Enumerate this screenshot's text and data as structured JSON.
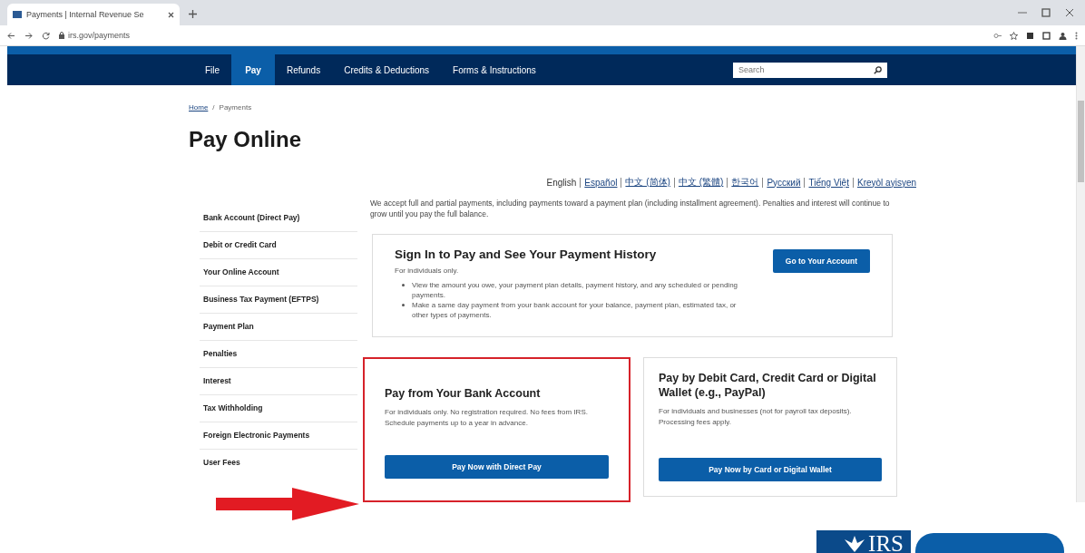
{
  "browser": {
    "tab_title": "Payments | Internal Revenue Se",
    "url": "irs.gov/payments"
  },
  "nav": {
    "items": [
      {
        "label": "File",
        "selected": false
      },
      {
        "label": "Pay",
        "selected": true
      },
      {
        "label": "Refunds",
        "selected": false
      },
      {
        "label": "Credits & Deductions",
        "selected": false
      },
      {
        "label": "Forms & Instructions",
        "selected": false
      }
    ],
    "search": {
      "placeholder": "Search"
    }
  },
  "breadcrumb": [
    {
      "label": "Home",
      "kind": "link"
    },
    {
      "label": "/",
      "kind": "separator"
    },
    {
      "label": "Payments",
      "kind": "current"
    }
  ],
  "title": "Pay Online",
  "languages": [
    {
      "label": "English",
      "selected": true
    },
    {
      "label": "Español",
      "selected": false
    },
    {
      "label": "中文 (简体)",
      "selected": false
    },
    {
      "label": "中文 (繁體)",
      "selected": false
    },
    {
      "label": "한국어",
      "selected": false
    },
    {
      "label": "Русский",
      "selected": false
    },
    {
      "label": "Tiếng Việt",
      "selected": false
    },
    {
      "label": "Kreyòl ayisyen",
      "selected": false
    }
  ],
  "sidebar": {
    "items": [
      "Bank Account (Direct Pay)",
      "Debit or Credit Card",
      "Your Online Account",
      "Business Tax Payment (EFTPS)",
      "Payment Plan",
      "Penalties",
      "Interest",
      "Tax Withholding",
      "Foreign Electronic Payments",
      "User Fees"
    ]
  },
  "intro": "We accept full and partial payments, including payments toward a payment plan (including installment agreement). Penalties and interest will continue to grow until you pay the full balance.",
  "signin_card": {
    "title": "Sign In to Pay and See Your Payment History",
    "subtitle": "For individuals only.",
    "bullets": [
      "View the amount you owe, your payment plan details, payment history, and any scheduled or pending payments.",
      "Make a same day payment from your bank account for your balance, payment plan, estimated tax, or other types of payments."
    ],
    "button": "Go to Your Account"
  },
  "options": [
    {
      "title": "Pay from Your Bank Account",
      "text": "For individuals only. No registration required. No fees from IRS. Schedule payments up to a year in advance.",
      "button": "Pay Now with Direct Pay",
      "highlighted": true
    },
    {
      "title": "Pay by Debit Card, Credit Card or Digital Wallet (e.g., PayPal)",
      "text": "For individuals and businesses (not for payroll tax deposits). Processing fees apply.",
      "button": "Pay Now by Card or Digital Wallet",
      "highlighted": false
    }
  ],
  "logo": "IRS"
}
